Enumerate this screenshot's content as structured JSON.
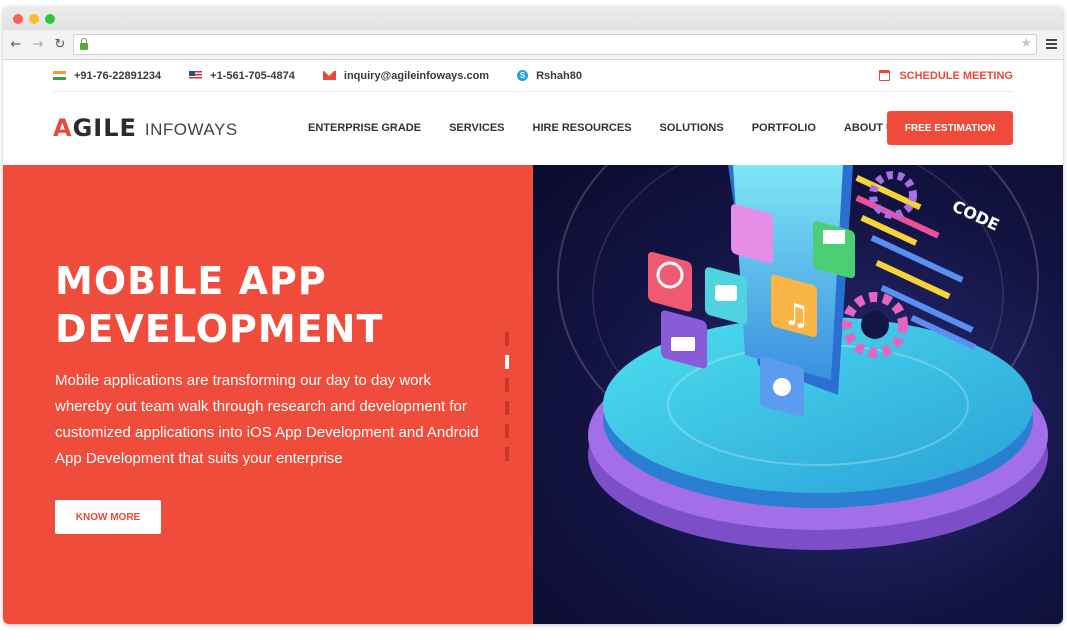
{
  "browser": {
    "back_icon": "arrow-left",
    "forward_icon": "arrow-right",
    "reload_icon": "reload",
    "url": "",
    "star_icon": "star",
    "menu_icon": "hamburger"
  },
  "topbar": {
    "phone_in": "+91-76-22891234",
    "phone_us": "+1-561-705-4874",
    "email": "inquiry@agileinfoways.com",
    "skype": "Rshah80",
    "schedule": "SCHEDULE MEETING"
  },
  "logo": {
    "mark": "AGILE",
    "sub": "INFOWAYS"
  },
  "nav": {
    "items": [
      {
        "label": "ENTERPRISE GRADE"
      },
      {
        "label": "SERVICES"
      },
      {
        "label": "HIRE RESOURCES"
      },
      {
        "label": "SOLUTIONS"
      },
      {
        "label": "PORTFOLIO"
      },
      {
        "label": "ABOUT US"
      }
    ],
    "cta": "FREE ESTIMATION"
  },
  "hero": {
    "title_line1": "MOBILE APP",
    "title_line2": "DEVELOPMENT",
    "description": "Mobile applications are transforming our day to day work whereby out team walk through research and development for customized applications into iOS App Development and Android App Development that suits your enterprise",
    "button": "KNOW MORE",
    "illustration_code_label": "CODE",
    "slide_count": 6,
    "active_slide": 2
  },
  "colors": {
    "brand_red": "#f04c3b",
    "hero_dark": "#141445",
    "cyan": "#2fd3e0",
    "purple": "#8a5bd8"
  }
}
